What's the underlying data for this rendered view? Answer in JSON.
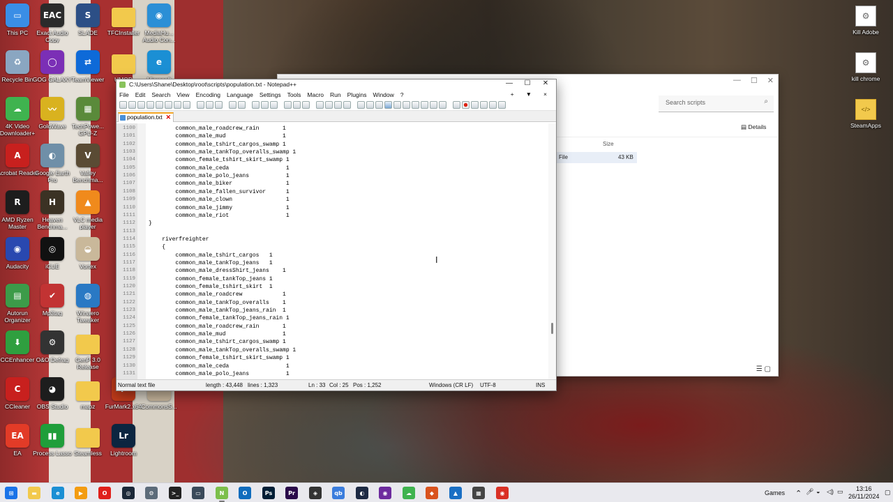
{
  "desktop": {
    "left_icons": [
      {
        "label": "This PC",
        "glyph": "pc-icon",
        "color": "#3a8ee6",
        "sym": "▭"
      },
      {
        "label": "Exact Audio Copy",
        "glyph": "eac-icon",
        "color": "#2b2b2b",
        "sym": "EAC"
      },
      {
        "label": "SLADE",
        "glyph": "slade-icon",
        "color": "#2c4f86",
        "sym": "S"
      },
      {
        "label": "TFCInstaller",
        "glyph": "folder-icon",
        "color": "#f2c94c",
        "sym": ""
      },
      {
        "label": "MediaHu... Audio Con...",
        "glyph": "mediahuman-icon",
        "color": "#2b8fd6",
        "sym": "◉"
      },
      {
        "label": "Recycle Bin",
        "glyph": "recycle-bin-icon",
        "color": "#8aa6c1",
        "sym": "♻"
      },
      {
        "label": "GOG GALAXY",
        "glyph": "gog-icon",
        "color": "#7b2fb6",
        "sym": "◯"
      },
      {
        "label": "TeamViewer",
        "glyph": "teamviewer-icon",
        "color": "#0e6ad8",
        "sym": "⇄"
      },
      {
        "label": "UMOD",
        "glyph": "folder-icon",
        "color": "#f2c94c",
        "sym": ""
      },
      {
        "label": "Microsoft",
        "glyph": "edge-icon",
        "color": "#1b8fd4",
        "sym": "e"
      },
      {
        "label": "4K Video Downloader+",
        "glyph": "4k-video-icon",
        "color": "#3fb34f",
        "sym": "☁"
      },
      {
        "label": "GoldWave",
        "glyph": "goldwave-icon",
        "color": "#d9b21f",
        "sym": "〰"
      },
      {
        "label": "TechPowe... GPU-Z",
        "glyph": "gpuz-icon",
        "color": "#5a8a3a",
        "sym": "▦"
      },
      {
        "label": "Acrobat Reader",
        "glyph": "acrobat-icon",
        "color": "#c8201e",
        "sym": "A"
      },
      {
        "label": "Google Earth Pro",
        "glyph": "google-earth-icon",
        "color": "#6f8fa8",
        "sym": "◐"
      },
      {
        "label": "Valley Benchma...",
        "glyph": "valley-icon",
        "color": "#5a4b34",
        "sym": "V"
      },
      {
        "label": "AMD Ryzen Master",
        "glyph": "ryzen-icon",
        "color": "#1d1d1d",
        "sym": "R"
      },
      {
        "label": "Heaven Benchma...",
        "glyph": "heaven-icon",
        "color": "#3b3224",
        "sym": "H"
      },
      {
        "label": "VLC media player",
        "glyph": "vlc-icon",
        "color": "#f08a1c",
        "sym": "▲"
      },
      {
        "label": "Audacity",
        "glyph": "audacity-icon",
        "color": "#2948b0",
        "sym": "◉"
      },
      {
        "label": "iCUE",
        "glyph": "icue-icon",
        "color": "#111111",
        "sym": "◎"
      },
      {
        "label": "Vortex",
        "glyph": "vortex-icon",
        "color": "#c9b89a",
        "sym": "◒"
      },
      {
        "label": "Autorun Organizer",
        "glyph": "autorun-icon",
        "color": "#3c9b49",
        "sym": "▤"
      },
      {
        "label": "Mp3tag",
        "glyph": "mp3tag-icon",
        "color": "#c23333",
        "sym": "✔"
      },
      {
        "label": "Winaero Tweaker",
        "glyph": "winaero-icon",
        "color": "#2a79c4",
        "sym": "◍"
      },
      {
        "label": "CCEnhancer",
        "glyph": "ccenhancer-icon",
        "color": "#2f9f3f",
        "sym": "⬇"
      },
      {
        "label": "O&O Defrag",
        "glyph": "defrag-icon",
        "color": "#333333",
        "sym": "⚙"
      },
      {
        "label": "GenP 3.0 Release",
        "glyph": "folder-icon",
        "color": "#f2c94c",
        "sym": ""
      },
      {
        "label": "CCleaner",
        "glyph": "ccleaner-icon",
        "color": "#c8201e",
        "sym": "C"
      },
      {
        "label": "OBS Studio",
        "glyph": "obs-icon",
        "color": "#1d1d1d",
        "sym": "◕"
      },
      {
        "label": "mapz",
        "glyph": "folder-icon",
        "color": "#f2c94c",
        "sym": ""
      },
      {
        "label": "FurMark2.x64",
        "glyph": "furmark-icon",
        "color": "#c13b1a",
        "sym": "F"
      },
      {
        "label": "CommonsS...",
        "glyph": "commons-icon",
        "color": "#c8b79d",
        "sym": ""
      },
      {
        "label": "EA",
        "glyph": "ea-icon",
        "color": "#e23b27",
        "sym": "EA"
      },
      {
        "label": "Process Lasso",
        "glyph": "process-lasso-icon",
        "color": "#1f9e3a",
        "sym": "▮▮"
      },
      {
        "label": "Steamless",
        "glyph": "folder-icon",
        "color": "#f2c94c",
        "sym": ""
      },
      {
        "label": "Lightroom",
        "glyph": "lightroom-icon",
        "color": "#0b2540",
        "sym": "Lr"
      }
    ],
    "right_icons": [
      {
        "label": "Kill Adobe",
        "glyph": "gear-doc-icon",
        "sym": "⚙"
      },
      {
        "label": "kill chrome",
        "glyph": "gear-doc-icon",
        "sym": "⚙"
      },
      {
        "label": "SteamApps",
        "glyph": "folder-icon",
        "sym": "</>"
      }
    ]
  },
  "explorer": {
    "search_placeholder": "Search scripts",
    "details_label": "Details",
    "col_size": "Size",
    "row_type": "File",
    "row_size": "43 KB"
  },
  "npp": {
    "title": "C:\\Users\\Shane\\Desktop\\root\\scripts\\population.txt - Notepad++",
    "menu": [
      "File",
      "Edit",
      "Search",
      "View",
      "Encoding",
      "Language",
      "Settings",
      "Tools",
      "Macro",
      "Run",
      "Plugins",
      "Window",
      "?"
    ],
    "menu_right": [
      "+",
      "▼",
      "×"
    ],
    "tab": "population.txt",
    "lines": [
      {
        "n": "1100",
        "t": "        common_male_roadcrew_rain       1"
      },
      {
        "n": "1101",
        "t": "        common_male_mud                 1"
      },
      {
        "n": "1102",
        "t": "        common_male_tshirt_cargos_swamp 1"
      },
      {
        "n": "1103",
        "t": "        common_male_tankTop_overalls_swamp 1"
      },
      {
        "n": "1104",
        "t": "        common_female_tshirt_skirt_swamp 1"
      },
      {
        "n": "1105",
        "t": "        common_male_ceda                 1"
      },
      {
        "n": "1106",
        "t": "        common_male_polo_jeans           1"
      },
      {
        "n": "1107",
        "t": "        common_male_biker                1"
      },
      {
        "n": "1108",
        "t": "        common_male_fallen_survivor      1"
      },
      {
        "n": "1109",
        "t": "        common_male_clown                1"
      },
      {
        "n": "1110",
        "t": "        common_male_jimmy                1"
      },
      {
        "n": "1111",
        "t": "        common_male_riot                 1"
      },
      {
        "n": "1112",
        "t": "}"
      },
      {
        "n": "1113",
        "t": ""
      },
      {
        "n": "1114",
        "t": "    riverfreighter"
      },
      {
        "n": "1115",
        "t": "    {"
      },
      {
        "n": "1116",
        "t": "        common_male_tshirt_cargos   1"
      },
      {
        "n": "1117",
        "t": "        common_male_tankTop_jeans   1"
      },
      {
        "n": "1118",
        "t": "        common_male_dressShirt_jeans    1"
      },
      {
        "n": "1119",
        "t": "        common_female_tankTop_jeans 1"
      },
      {
        "n": "1120",
        "t": "        common_female_tshirt_skirt  1"
      },
      {
        "n": "1121",
        "t": "        common_male_roadcrew            1"
      },
      {
        "n": "1122",
        "t": "        common_male_tankTop_overalls    1"
      },
      {
        "n": "1123",
        "t": "        common_male_tankTop_jeans_rain  1"
      },
      {
        "n": "1124",
        "t": "        common_female_tankTop_jeans_rain 1"
      },
      {
        "n": "1125",
        "t": "        common_male_roadcrew_rain       1"
      },
      {
        "n": "1126",
        "t": "        common_male_mud                 1"
      },
      {
        "n": "1127",
        "t": "        common_male_tshirt_cargos_swamp 1"
      },
      {
        "n": "1128",
        "t": "        common_male_tankTop_overalls_swamp 1"
      },
      {
        "n": "1129",
        "t": "        common_female_tshirt_skirt_swamp 1"
      },
      {
        "n": "1130",
        "t": "        common_male_ceda                 1"
      },
      {
        "n": "1131",
        "t": "        common_male_polo_jeans           1"
      }
    ],
    "status": {
      "type": "Normal text file",
      "length": "length : 43,448",
      "lines": "lines : 1,323",
      "ln": "Ln : 33",
      "col": "Col : 25",
      "pos": "Pos : 1,252",
      "eol": "Windows (CR LF)",
      "enc": "UTF-8",
      "mode": "INS"
    }
  },
  "taskbar": {
    "apps": [
      {
        "name": "start-icon",
        "color": "#1a73e8",
        "sym": "⊞"
      },
      {
        "name": "file-explorer-icon",
        "color": "#f2c94c",
        "sym": "▬"
      },
      {
        "name": "edge-icon",
        "color": "#1b8fd4",
        "sym": "e"
      },
      {
        "name": "media-player-icon",
        "color": "#f39c12",
        "sym": "▶"
      },
      {
        "name": "opera-icon",
        "color": "#e0201b",
        "sym": "O"
      },
      {
        "name": "steam-icon",
        "color": "#1b2838",
        "sym": "◎"
      },
      {
        "name": "settings-icon",
        "color": "#5c6b7a",
        "sym": "⚙"
      },
      {
        "name": "terminal-icon",
        "color": "#222222",
        "sym": ">_"
      },
      {
        "name": "monitor-icon",
        "color": "#3a4a5a",
        "sym": "▭"
      },
      {
        "name": "notepadpp-icon",
        "color": "#7cbf4b",
        "sym": "N",
        "active": true
      },
      {
        "name": "outlook-icon",
        "color": "#0f6cbd",
        "sym": "O"
      },
      {
        "name": "photoshop-icon",
        "color": "#001e36",
        "sym": "Ps"
      },
      {
        "name": "premiere-icon",
        "color": "#2a0a4a",
        "sym": "Pr"
      },
      {
        "name": "davinci-icon",
        "color": "#333333",
        "sym": "◈"
      },
      {
        "name": "qbittorrent-icon",
        "color": "#3b7ddd",
        "sym": "qb"
      },
      {
        "name": "blender-icon",
        "color": "#1d2a44",
        "sym": "◐"
      },
      {
        "name": "media-icon",
        "color": "#6d2b9e",
        "sym": "◉"
      },
      {
        "name": "4k-icon",
        "color": "#3fb34f",
        "sym": "☁"
      },
      {
        "name": "remote-icon",
        "color": "#d9531e",
        "sym": "◆"
      },
      {
        "name": "photos-icon",
        "color": "#1a6fc4",
        "sym": "▲"
      },
      {
        "name": "gallery-icon",
        "color": "#444444",
        "sym": "▦"
      },
      {
        "name": "chrome-icon",
        "color": "#d93025",
        "sym": "◉"
      }
    ],
    "games_label": "Games",
    "time": "13:16",
    "date": "26/11/2024"
  }
}
